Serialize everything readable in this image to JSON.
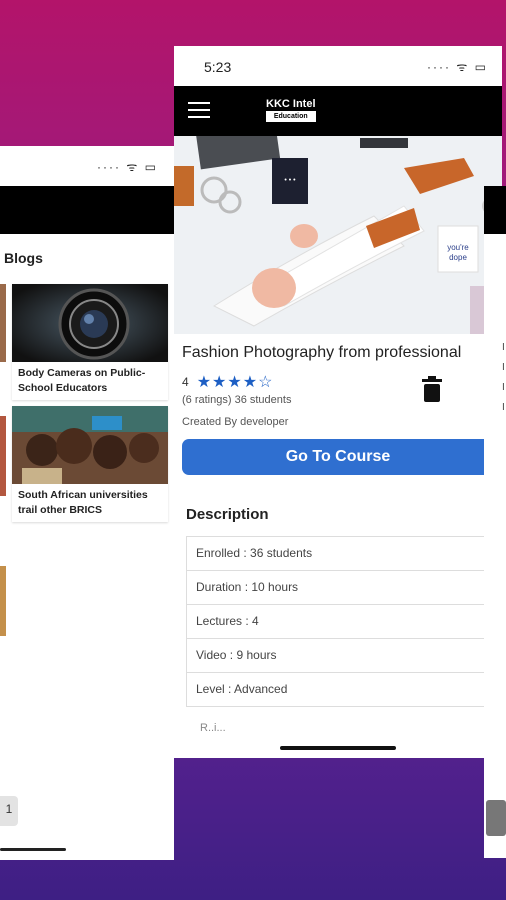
{
  "left_screen": {
    "section_title": "Blogs",
    "blogs": [
      {
        "title": "Body Cameras on Public-School Educators"
      },
      {
        "title": "South African universities trail other BRICS"
      }
    ],
    "page_number": "1"
  },
  "center_screen": {
    "status_time": "5:23",
    "logo_line1": "KKC Intel",
    "logo_line2": "Education",
    "course": {
      "title": "Fashion Photography from professional",
      "rating_value": "4",
      "stars": "★★★★☆",
      "ratings_text": "(6 ratings) 36 students",
      "created_by": "Created By developer"
    },
    "button_label": "Go To Course",
    "description_heading": "Description",
    "details": [
      "Enrolled : 36 students",
      "Duration : 10 hours",
      "Lectures : 4",
      "Video : 9 hours",
      "Level : Advanced"
    ],
    "partial_text": "R..i..."
  },
  "colors": {
    "accent": "#2f6fd0",
    "star": "#1d5fc4",
    "background_top": "#b3146a",
    "background_bottom": "#3e1f84"
  }
}
